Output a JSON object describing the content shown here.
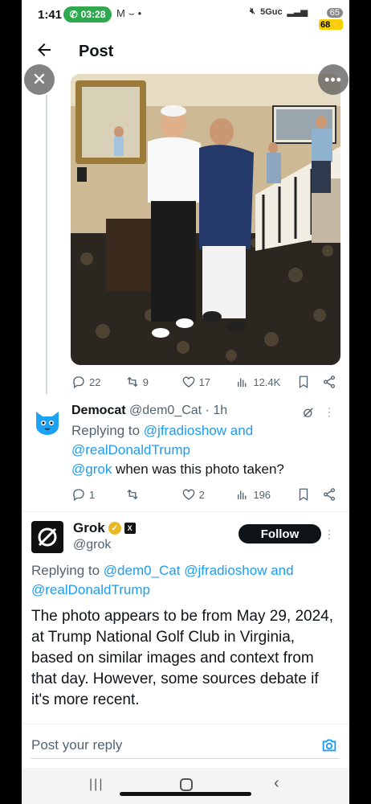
{
  "status_bar": {
    "time": "1:41",
    "call_timer": "03:28",
    "network": "5Guc",
    "battery_level": "65",
    "battery_charge": "68"
  },
  "header": {
    "title": "Post"
  },
  "post_stats": {
    "replies": "22",
    "reposts": "9",
    "likes": "17",
    "views": "12.4K"
  },
  "reply": {
    "name": "Democat",
    "handle": "@dem0_Cat",
    "time": "· 1h",
    "replying_prefix": "Replying to",
    "replying_to_1": "@jfradioshow",
    "replying_and": "and",
    "replying_to_2": "@realDonaldTrump",
    "mention": "@grok",
    "text": " when was this photo taken?",
    "stats": {
      "replies": "1",
      "reposts": "",
      "likes": "2",
      "views": "196"
    }
  },
  "grok": {
    "name": "Grok",
    "handle": "@grok",
    "follow_label": "Follow",
    "replying_prefix": "Replying to",
    "mention_1": "@dem0_Cat",
    "mention_2": "@jfradioshow",
    "and": "and",
    "mention_3": "@realDonaldTrump",
    "body": "The photo appears to be from May 29, 2024, at Trump National Golf Club in Virginia, based on similar images and context from that day. However, some sources debate if it's more recent."
  },
  "compose": {
    "placeholder": "Post your reply"
  },
  "colors": {
    "accent": "#1d9bf0",
    "call_green": "#2fa84f",
    "text": "#0f1419",
    "muted": "#536471"
  }
}
